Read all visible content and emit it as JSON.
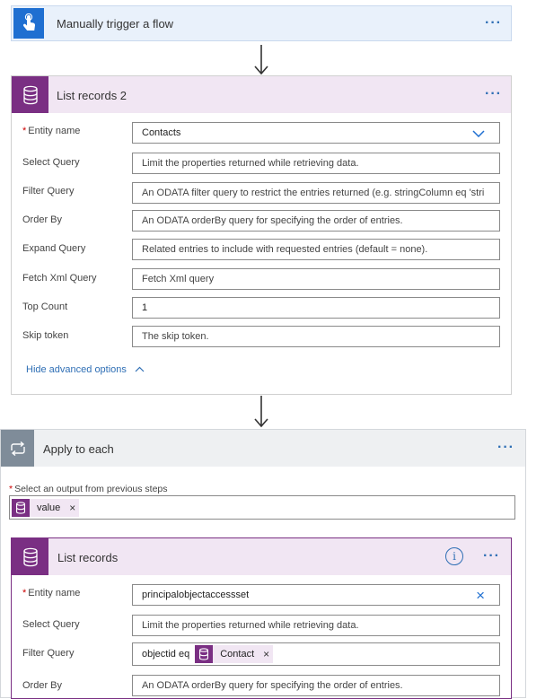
{
  "colors": {
    "trigger_header_bg": "#e9f1fb",
    "trigger_icon_bg": "#1f6fd1",
    "dataverse_icon_bg": "#7a2f83",
    "dataverse_header_bg": "#f1e6f3",
    "apply_header_bg": "#eef0f2",
    "apply_icon_bg": "#7f8c99",
    "link": "#2f6fb5",
    "required": "#cc0000"
  },
  "trigger": {
    "title": "Manually trigger a flow",
    "icon": "touch-hand-icon",
    "more": "···"
  },
  "list_records_2": {
    "title": "List records 2",
    "icon": "database-icon",
    "more": "···",
    "required_mark": "*",
    "entity_label": "Entity name",
    "entity_value": "Contacts",
    "fields": [
      {
        "label": "Select Query",
        "placeholder": "Limit the properties returned while retrieving data."
      },
      {
        "label": "Filter Query",
        "placeholder": "An ODATA filter query to restrict the entries returned (e.g. stringColumn eq 'stri"
      },
      {
        "label": "Order By",
        "placeholder": "An ODATA orderBy query for specifying the order of entries."
      },
      {
        "label": "Expand Query",
        "placeholder": "Related entries to include with requested entries (default = none)."
      },
      {
        "label": "Fetch Xml Query",
        "placeholder": "Fetch Xml query"
      },
      {
        "label": "Top Count",
        "value": "1"
      },
      {
        "label": "Skip token",
        "placeholder": "The skip token."
      }
    ],
    "advanced_link": "Hide advanced options"
  },
  "apply_to_each": {
    "title": "Apply to each",
    "icon": "loop-icon",
    "more": "···",
    "required_mark": "*",
    "select_label": "Select an output from previous steps",
    "token_label": "value",
    "token_remove": "×"
  },
  "list_records": {
    "title": "List records",
    "icon": "database-icon",
    "info": "i",
    "more": "···",
    "required_mark": "*",
    "entity_label": "Entity name",
    "entity_value": "principalobjectaccessset",
    "entity_clear": "×",
    "select_label": "Select Query",
    "select_placeholder": "Limit the properties returned while retrieving data.",
    "filter_label": "Filter Query",
    "filter_prefix": "objectid eq",
    "filter_token": "Contact",
    "filter_token_remove": "×",
    "order_label": "Order By",
    "order_placeholder": "An ODATA orderBy query for specifying the order of entries."
  }
}
